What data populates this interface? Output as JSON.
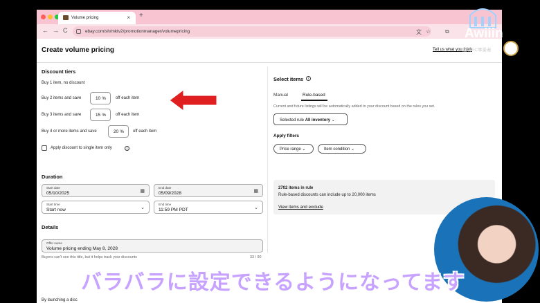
{
  "browser": {
    "tab_title": "Volume pricing",
    "tab_close": "×",
    "new_tab": "+",
    "url": "ebay.com/sh/mktv2/promotionmanager/volumepricing",
    "nav_back": "←",
    "nav_forward": "→",
    "nav_reload": "C"
  },
  "page": {
    "title": "Create volume pricing",
    "feedback_link": "Tell us what you think"
  },
  "discount_tiers": {
    "title": "Discount tiers",
    "tier1": "Buy 1 item, no discount",
    "tier2_label": "Buy 2 items and save",
    "tier2_value": "10",
    "tier3_label": "Buy 3 items and save",
    "tier3_value": "15",
    "tier4_label": "Buy 4 or more items and save",
    "tier4_value": "20",
    "pct_symbol": "%",
    "suffix": "off each item",
    "apply_single": "Apply discount to single item only",
    "info_glyph": "i"
  },
  "duration": {
    "title": "Duration",
    "start_date_label": "Start date",
    "start_date": "05/10/2025",
    "end_date_label": "End date",
    "end_date": "05/09/2028",
    "start_time_label": "Start time",
    "start_time": "Start now",
    "end_time_label": "End time",
    "end_time": "11:59 PM PDT",
    "calendar_icon": "▦",
    "chevron_icon": "⌄"
  },
  "details": {
    "title": "Details",
    "offer_label": "Offer name",
    "offer_value": "Volume pricing ending May 8, 2028",
    "helper": "Buyers can't see this title, but it helps track your discounts",
    "counter": "33 / 90"
  },
  "select_items": {
    "title": "Select items",
    "tab_manual": "Manual",
    "tab_rule": "Rule-based",
    "description": "Current and future listings will be automatically added to your discount based on the rules you set.",
    "rule_label": "Selected rule",
    "rule_value": "All inventory",
    "filters_title": "Apply filters",
    "filter1": "Price range",
    "filter2": "Item condition",
    "items_count": "2702 items in rule",
    "items_note": "Rule-based discounts can include up to 20,000 items",
    "view_link": "View items and exclude"
  },
  "footer": {
    "launch_text": "By launching a disc"
  },
  "overlay": {
    "caption": "バラバラに設定できるようになってます",
    "logo": "Awiiin",
    "sub_text": "越境EC事業者"
  },
  "colors": {
    "tab_bar": "#f9c4d2",
    "arrow": "#e02020",
    "caption": "#c7a3ff"
  }
}
